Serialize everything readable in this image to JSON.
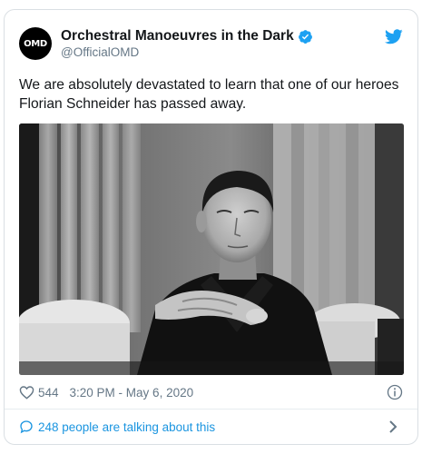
{
  "account": {
    "avatar_text": "OMD",
    "display_name": "Orchestral Manoeuvres in the Dark",
    "handle": "@OfficialOMD",
    "verified": true
  },
  "tweet": {
    "text": "We are absolutely devastated to learn that one of our heroes Florian Schneider has passed away.",
    "like_count": "544",
    "timestamp": "3:20 PM - May 6, 2020"
  },
  "footer": {
    "talking_text": "248 people are talking about this"
  },
  "icons": {
    "brand": "twitter-bird-icon",
    "verified": "verified-badge-icon",
    "like": "heart-icon",
    "info": "info-icon",
    "conversation": "speech-bubble-icon",
    "more": "chevron-right-icon"
  },
  "colors": {
    "twitter_blue": "#1da1f2",
    "link_blue": "#1b95e0",
    "muted_gray": "#657786",
    "text": "#14171a",
    "border": "#dadfe3"
  }
}
